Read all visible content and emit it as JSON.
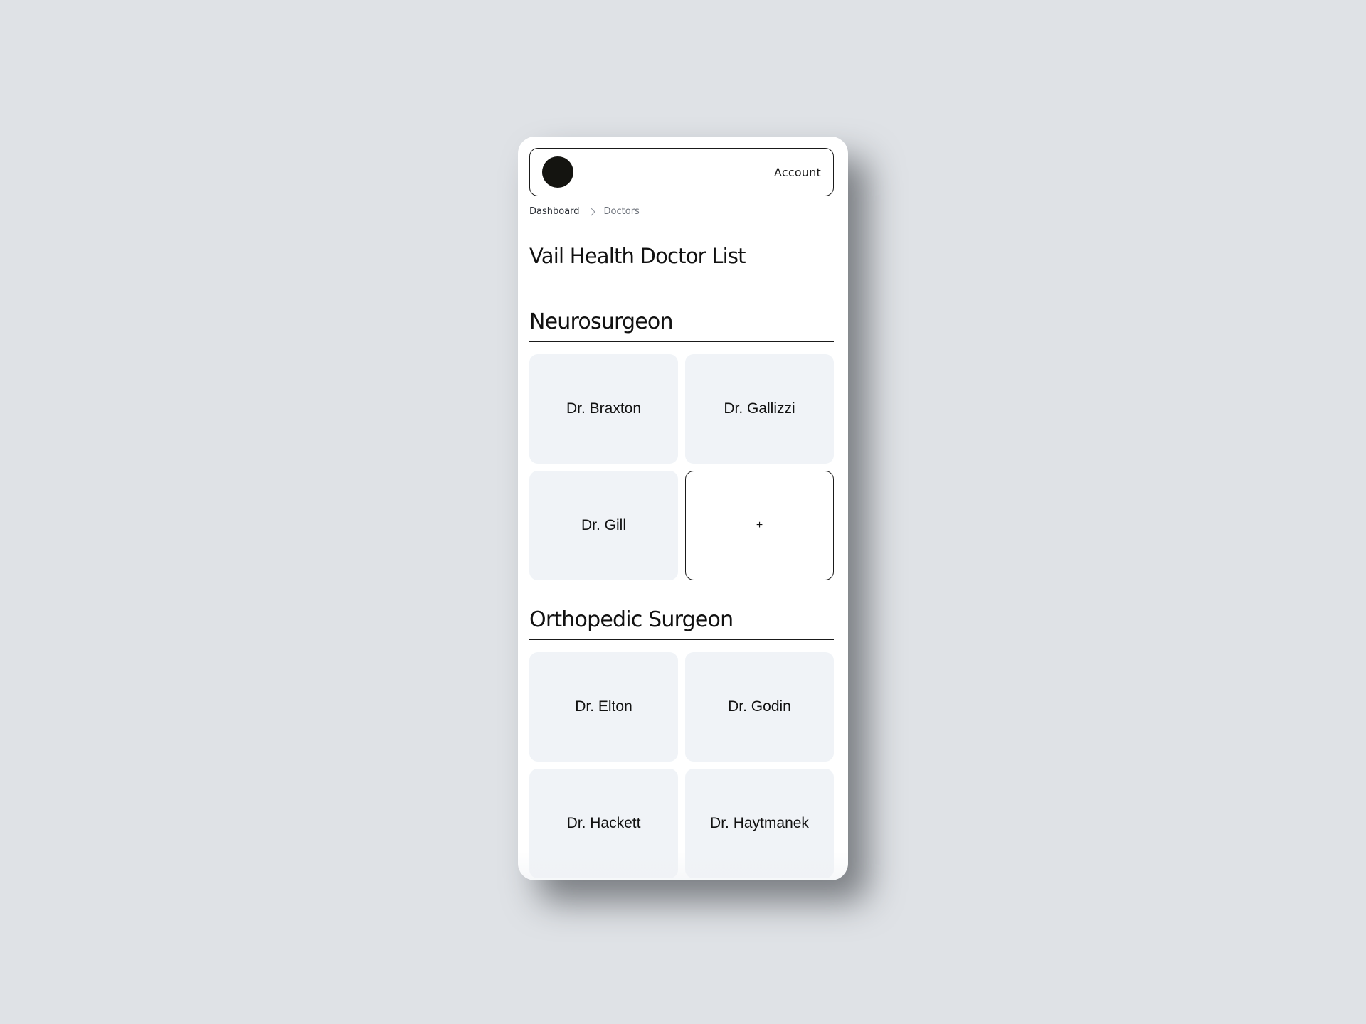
{
  "header": {
    "account_label": "Account"
  },
  "breadcrumb": {
    "items": [
      "Dashboard",
      "Doctors"
    ]
  },
  "page": {
    "title": "Vail Health Doctor List"
  },
  "sections": [
    {
      "title": "Neurosurgeon",
      "doctors": [
        "Dr. Braxton",
        "Dr. Gallizzi",
        "Dr. Gill"
      ],
      "add_label": "+"
    },
    {
      "title": "Orthopedic Surgeon",
      "doctors": [
        "Dr. Elton",
        "Dr. Godin",
        "Dr. Hackett",
        "Dr. Haytmanek"
      ]
    }
  ],
  "colors": {
    "background": "#dfe2e6",
    "card": "#f0f3f7",
    "ink": "#111111"
  },
  "icons": {
    "avatar": "avatar-circle",
    "breadcrumb_separator": "chevron-right-icon",
    "add": "plus-icon"
  }
}
